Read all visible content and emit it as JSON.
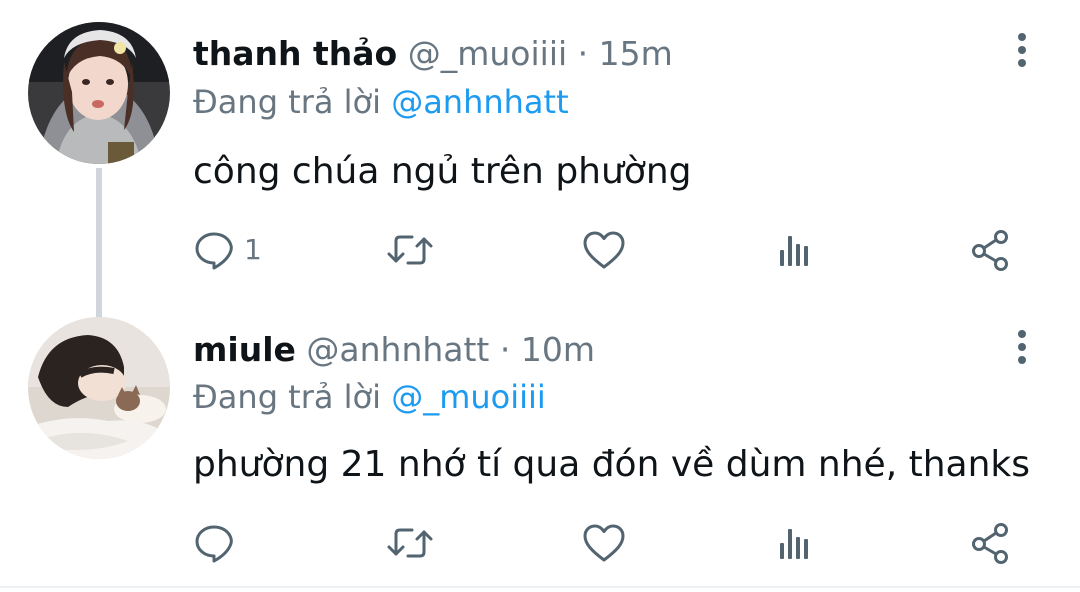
{
  "thread": [
    {
      "display_name": "thanh thảo",
      "handle": "@_muoiiii",
      "separator": "·",
      "time": "15m",
      "replying_prefix": "Đang trả lời",
      "replying_to": "@anhnhatt",
      "text": "công chúa ngủ trên phường",
      "reply_count": "1",
      "avatar_icon": "avatar-photo"
    },
    {
      "display_name": "miule",
      "handle": "@anhnhatt",
      "separator": "·",
      "time": "10m",
      "replying_prefix": "Đang trả lời",
      "replying_to": "@_muoiiii",
      "text": "phường 21 nhớ tí qua đón về dùm nhé, thanks",
      "reply_count": "",
      "avatar_icon": "avatar-photo"
    }
  ],
  "icons": {
    "reply": "reply-icon",
    "retweet": "retweet-icon",
    "like": "like-icon",
    "views": "views-icon",
    "share": "share-icon",
    "more": "more-options-icon"
  },
  "colors": {
    "text_primary": "#0f1419",
    "text_secondary": "#687682",
    "link": "#1d9bf0",
    "thread_line": "#d0d6db",
    "icon": "#536471"
  }
}
